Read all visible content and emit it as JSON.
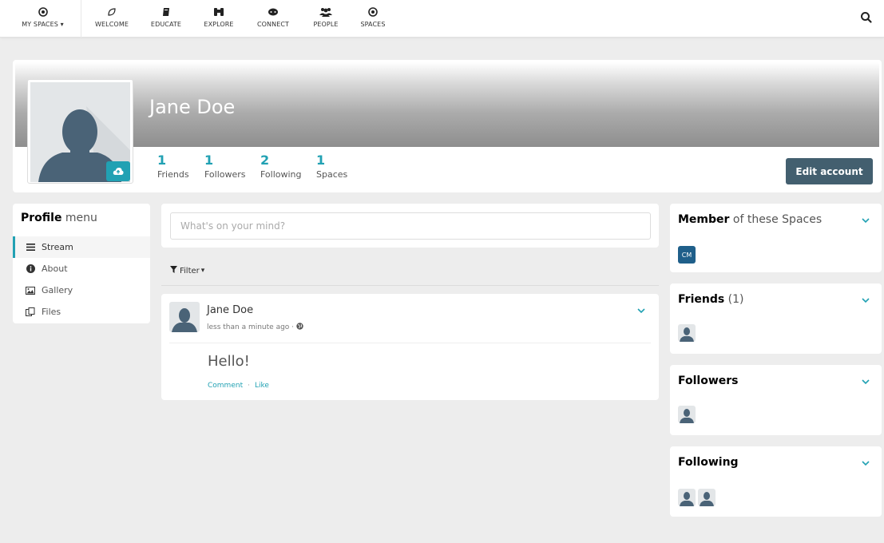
{
  "nav": {
    "items": [
      {
        "label": "MY SPACES",
        "icon": "spaces-dot-icon"
      },
      {
        "label": "WELCOME",
        "icon": "leaf-icon"
      },
      {
        "label": "EDUCATE",
        "icon": "book-icon"
      },
      {
        "label": "EXPLORE",
        "icon": "binoculars-icon"
      },
      {
        "label": "CONNECT",
        "icon": "gamepad-icon"
      },
      {
        "label": "PEOPLE",
        "icon": "users-icon"
      },
      {
        "label": "SPACES",
        "icon": "dot-circle-icon"
      }
    ]
  },
  "profile": {
    "name": "Jane Doe",
    "stats": [
      {
        "value": "1",
        "label": "Friends"
      },
      {
        "value": "1",
        "label": "Followers"
      },
      {
        "value": "2",
        "label": "Following"
      },
      {
        "value": "1",
        "label": "Spaces"
      }
    ],
    "edit_label": "Edit account"
  },
  "menu": {
    "title_bold": "Profile",
    "title_rest": " menu",
    "items": [
      {
        "label": "Stream"
      },
      {
        "label": "About"
      },
      {
        "label": "Gallery"
      },
      {
        "label": "Files"
      }
    ]
  },
  "composer": {
    "placeholder": "What's on your mind?"
  },
  "filter": {
    "label": "Filter"
  },
  "post": {
    "author": "Jane Doe",
    "time": "less than a minute ago ·",
    "content": "Hello!",
    "comment_label": "Comment",
    "like_label": "Like",
    "separator": "·"
  },
  "widgets": {
    "member": {
      "title_bold": "Member",
      "title_rest": " of these Spaces",
      "space_initials": "CM"
    },
    "friends": {
      "title_bold": "Friends",
      "title_rest": " (1)"
    },
    "followers": {
      "title_bold": "Followers"
    },
    "following": {
      "title_bold": "Following"
    }
  },
  "colors": {
    "accent": "#21a1b3",
    "button": "#435f6f",
    "space_badge": "#1f5f8a"
  }
}
